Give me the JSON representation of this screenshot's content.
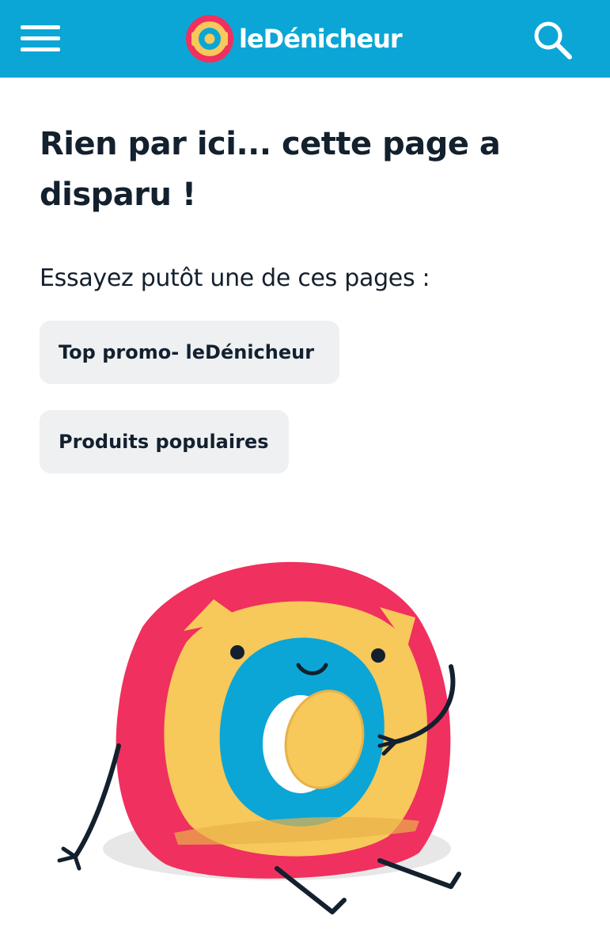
{
  "header": {
    "menu_icon": "hamburger-menu-icon",
    "logo": {
      "text": "leDénicheur",
      "mark_colors": [
        "#f0305e",
        "#f7c85a",
        "#0ba6d6"
      ]
    },
    "search_icon": "search-icon",
    "background_color": "#0ba6d6"
  },
  "main": {
    "title": "Rien par ici... cette page a disparu !",
    "subtitle": "Essayez putôt une de ces pages :",
    "links": [
      {
        "label": "Top promo- leDénicheur"
      },
      {
        "label": "Produits populaires"
      }
    ],
    "illustration": "mascot-holding-coin-illustration"
  },
  "colors": {
    "text": "#13202e",
    "chip_background": "#eef0f2",
    "mascot_red": "#f0305e",
    "mascot_yellow": "#f7c85a",
    "mascot_blue": "#0ba6d6"
  }
}
